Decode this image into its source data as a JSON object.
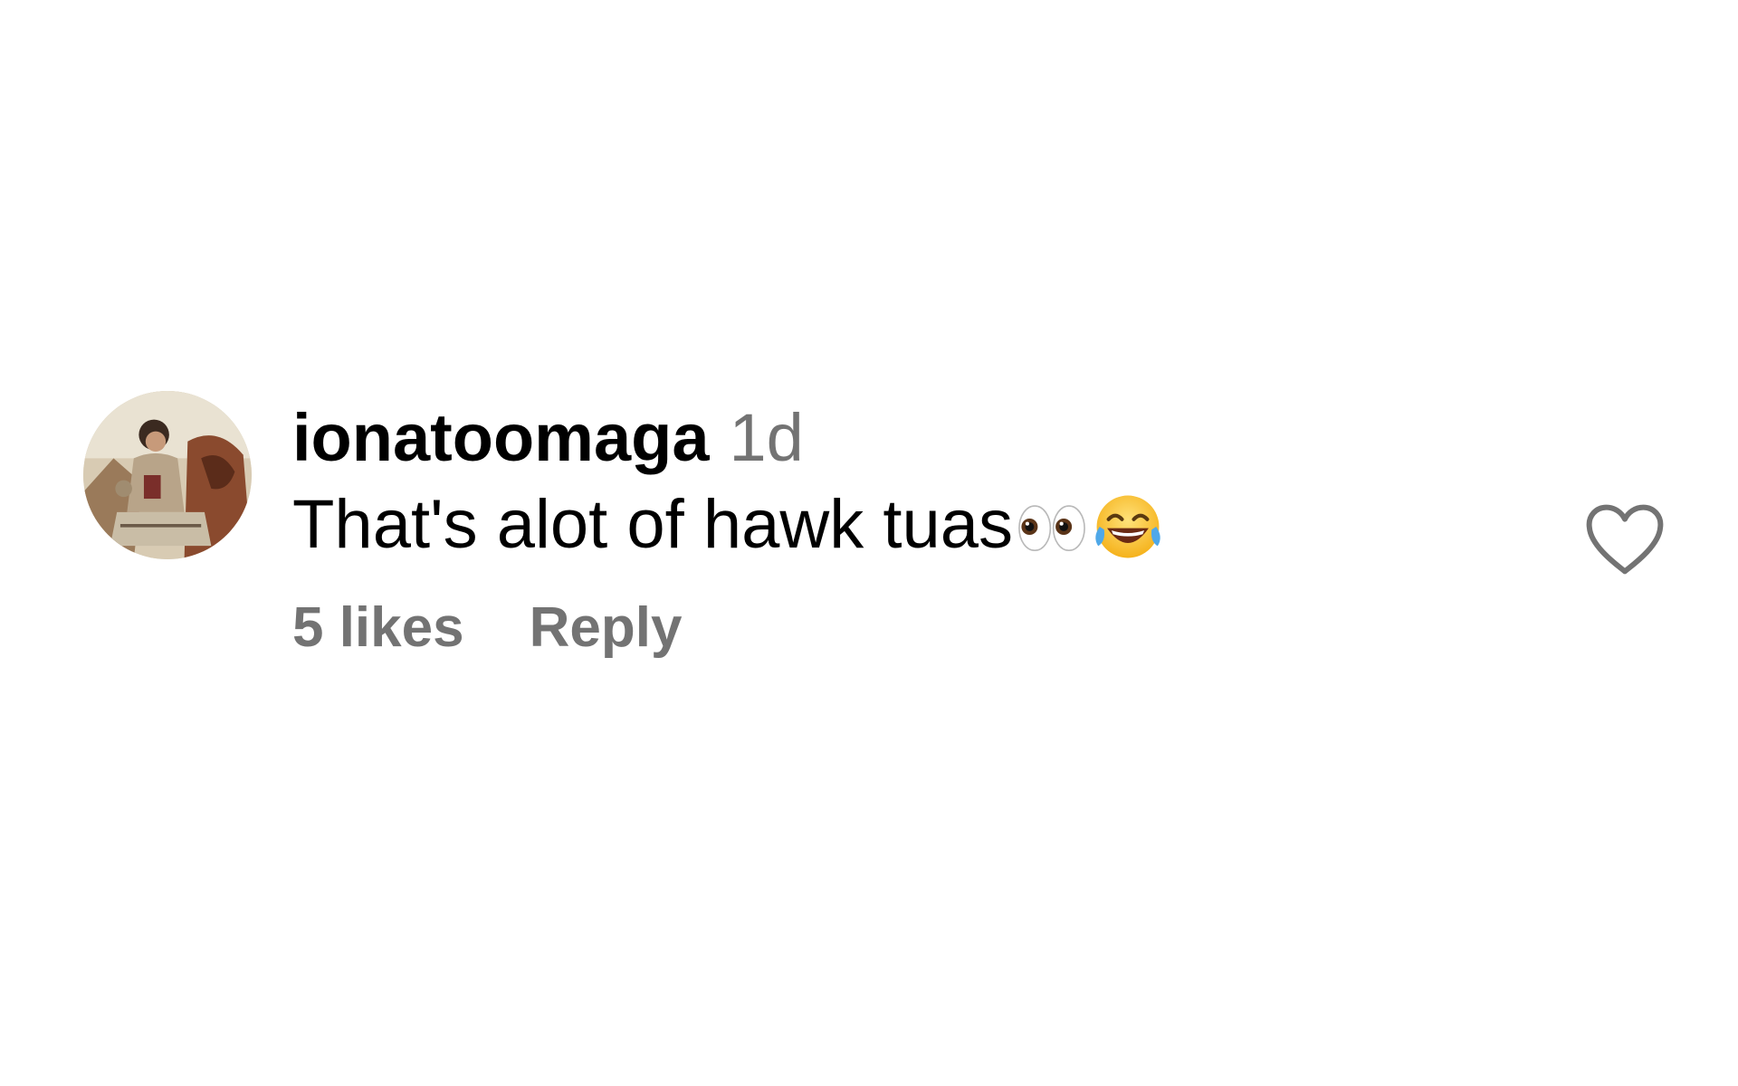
{
  "comment": {
    "username": "ionatoomaga",
    "timestamp": "1d",
    "text": "That's alot of hawk tuas",
    "emojis": [
      "eyes-emoji",
      "face-with-tears-of-joy-emoji"
    ],
    "likes_label": "5 likes",
    "reply_label": "Reply",
    "avatar_icon": "user-avatar",
    "like_icon": "heart-outline-icon"
  },
  "colors": {
    "background": "#ffffff",
    "primary_text": "#000000",
    "secondary_text": "#737373"
  }
}
